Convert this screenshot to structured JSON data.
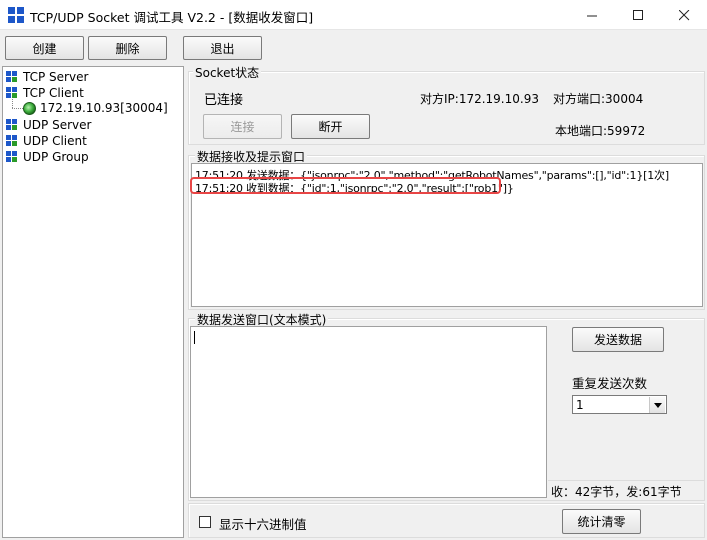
{
  "window": {
    "title": "TCP/UDP Socket 调试工具 V2.2 - [数据收发窗口]"
  },
  "toolbar": {
    "create_label": "创建",
    "delete_label": "删除",
    "exit_label": "退出"
  },
  "tree": {
    "items": [
      {
        "label": "TCP Server"
      },
      {
        "label": "TCP Client"
      },
      {
        "label": "172.19.10.93[30004]"
      },
      {
        "label": "UDP Server"
      },
      {
        "label": "UDP Client"
      },
      {
        "label": "UDP Group"
      }
    ]
  },
  "socket_status": {
    "group_label": "Socket状态",
    "state": "已连接",
    "peer_ip": "对方IP:172.19.10.93",
    "peer_port": "对方端口:30004",
    "connect_label": "连接",
    "disconnect_label": "断开",
    "local_port": "本地端口:59972"
  },
  "receive": {
    "group_label": "数据接收及提示窗口",
    "lines": [
      "17:51:20 发送数据：{\"jsonrpc\":\"2.0\",\"method\":\"getRobotNames\",\"params\":[],\"id\":1}[1次]",
      "17:51:20 收到数据：{\"id\":1,\"jsonrpc\":\"2.0\",\"result\":[\"rob1\"]}"
    ]
  },
  "send": {
    "group_label": "数据发送窗口(文本模式)",
    "input_value": "",
    "send_label": "发送数据",
    "repeat_label": "重复发送次数",
    "repeat_value": "1",
    "stats": "收：42字节，发:61字节"
  },
  "bottom": {
    "hex_label": "显示十六进制值",
    "hex_checked": false,
    "clear_label": "统计清零"
  },
  "colors": {
    "accent": "#1d57c9",
    "highlight": "#e84545",
    "status_ok": "#3fb03f"
  }
}
